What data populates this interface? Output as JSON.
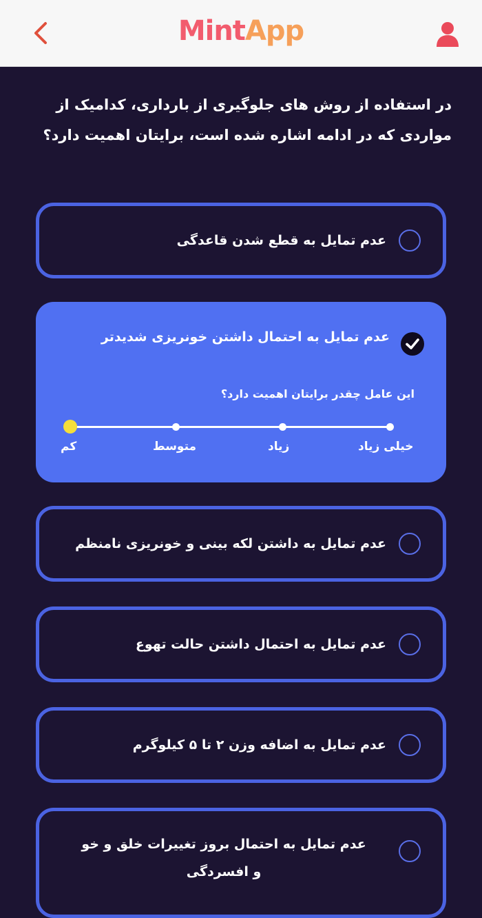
{
  "header": {
    "logo_part1": "Mint",
    "logo_part2": "App"
  },
  "question": "در استفاده از روش های جلوگیری از بارداری، کدامیک از مواردی که در ادامه اشاره شده است، برایتان اهمیت دارد؟",
  "options": [
    {
      "label": "عدم تمایل به قطع شدن قاعدگی",
      "selected": false
    },
    {
      "label": "عدم تمایل به احتمال داشتن خونریزی شدیدتر",
      "selected": true
    },
    {
      "label": "عدم تمایل به داشتن لکه بینی و خونریزی نامنظم",
      "selected": false
    },
    {
      "label": "عدم تمایل به احتمال داشتن حالت تهوع",
      "selected": false
    },
    {
      "label": "عدم تمایل به اضافه وزن ۲ تا ۵ کیلوگرم",
      "selected": false
    },
    {
      "label": "عدم تمایل به احتمال بروز تغییرات خلق و خو و افسردگی",
      "selected": false
    }
  ],
  "importance": {
    "question": "این عامل چقدر برایتان اهمیت دارد؟",
    "levels": [
      "خیلی زیاد",
      "زیاد",
      "متوسط",
      "کم"
    ],
    "selected_level": "کم"
  },
  "colors": {
    "background": "#1c1432",
    "accent": "#5070f2",
    "border": "#4b63e2",
    "slider_active": "#f4de3a"
  }
}
